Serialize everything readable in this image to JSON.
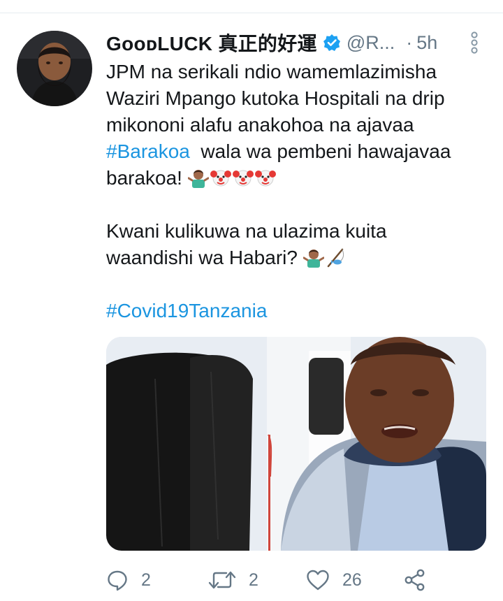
{
  "tweet": {
    "display_name": "GᴏᴏᴅLUCK 真正的好運",
    "handle": "@R...",
    "time": "5h",
    "text": {
      "line1": "JPM na serikali ndio wamemlazimisha",
      "line2": "Waziri Mpango kutoka Hospitali na drip",
      "line3": "mikononi alafu anakohoa na ajavaa",
      "hashtag_barakoa": "#Barakoa",
      "line4_rest": "  wala wa pembeni hawajavaa",
      "line5": "barakoa! ",
      "line6": "Kwani kulikuwa na ulazima kuita",
      "line7": "waandishi wa Habari? ",
      "hashtag_covid": "#Covid19Tanzania"
    },
    "emojis_line5": [
      "person-shrugging",
      "clown-face",
      "clown-face",
      "clown-face"
    ],
    "emojis_line7": [
      "person-shrugging",
      "fishing-pole"
    ],
    "actions": {
      "reply_count": "2",
      "retweet_count": "2",
      "like_count": "26"
    }
  },
  "colors": {
    "text": "#14171a",
    "secondary": "#657786",
    "link": "#1b95e0",
    "verified": "#1da1f2"
  },
  "icons": [
    "verified-badge-icon",
    "more-vertical-icon",
    "reply-icon",
    "retweet-icon",
    "like-icon",
    "share-icon"
  ]
}
